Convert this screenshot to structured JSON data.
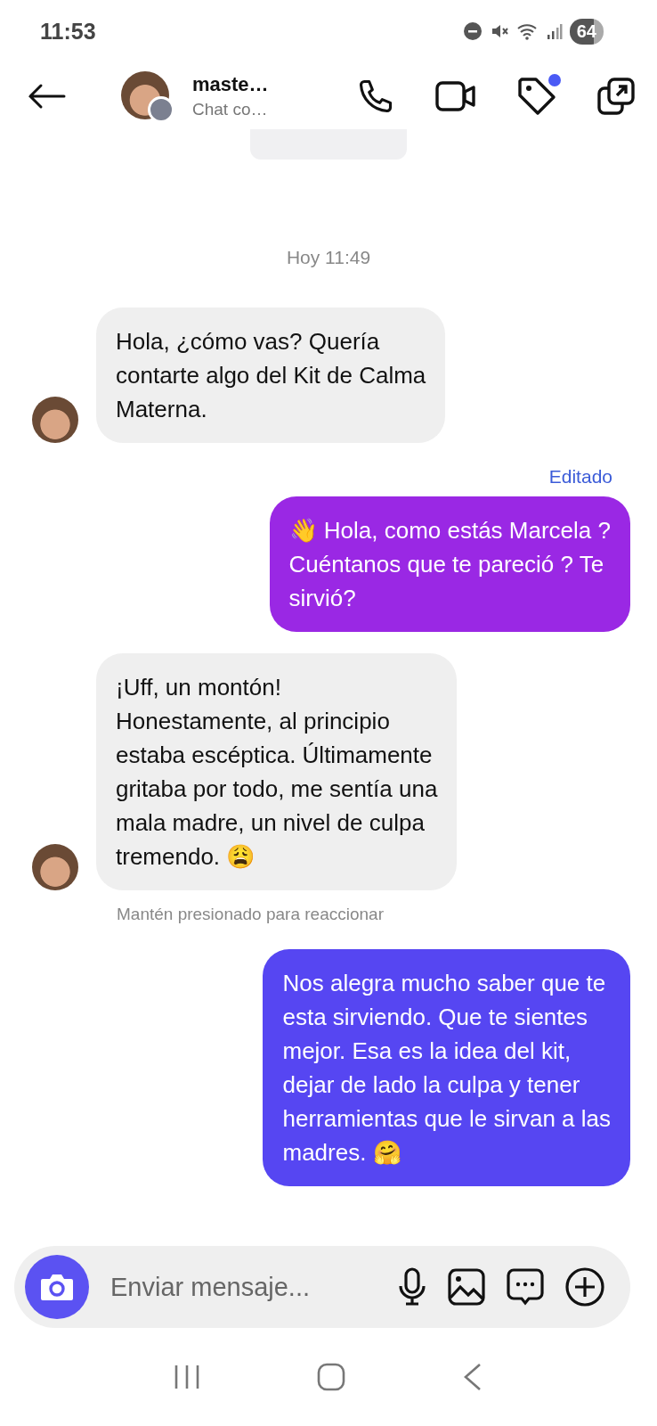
{
  "status_bar": {
    "time": "11:53",
    "battery": "64"
  },
  "header": {
    "name": "maste…",
    "subtitle": "Chat co…",
    "tag_badge": true
  },
  "timestamp": "Hoy 11:49",
  "messages": [
    {
      "kind": "incoming",
      "text": "Hola, ¿cómo vas? Quería\ncontarte algo del Kit de Calma\nMaterna.",
      "avatar": true
    },
    {
      "kind": "note",
      "text": "Editado"
    },
    {
      "kind": "outgoing",
      "text": "👋 Hola, como estás Marcela ?\nCuéntanos que te pareció ? Te\nsirvió?",
      "color": "#9a28e4"
    },
    {
      "kind": "incoming",
      "text": "¡Uff, un montón!\nHonestamente, al principio\nestaba escéptica. Últimamente\ngritaba por todo, me sentía una\nmala madre, un nivel de culpa\ntremendo. 😩",
      "avatar": true
    },
    {
      "kind": "hint",
      "text": "Mantén presionado para reaccionar"
    },
    {
      "kind": "outgoing",
      "text": "Nos alegra mucho saber que te\nesta sirviendo. Que te sientes\nmejor. Esa es la idea del kit,\ndejar de lado la culpa y tener\nherramientas que le sirvan a las\nmadres. 🤗",
      "color": "#5646f2"
    }
  ],
  "composer": {
    "placeholder": "Enviar mensaje..."
  }
}
